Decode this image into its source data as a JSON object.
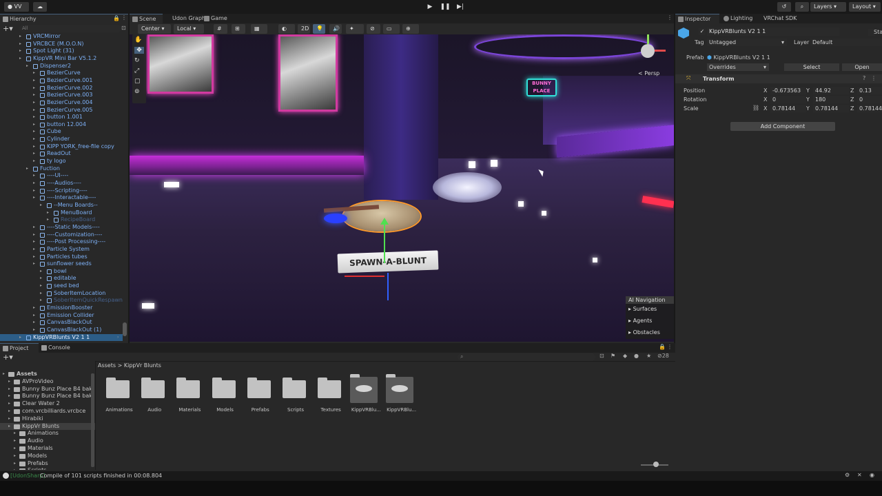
{
  "topbar": {
    "account": "VV",
    "layers": "Layers",
    "layout": "Layout"
  },
  "hierarchy": {
    "tab": "Hierarchy",
    "search_placeholder": "All",
    "items": [
      {
        "label": "VRCMirror",
        "depth": 3,
        "state": "normal"
      },
      {
        "label": "VRCBCE (M.O.O.N)",
        "depth": 3,
        "state": "normal"
      },
      {
        "label": "Spot Light (31)",
        "depth": 3,
        "state": "normal"
      },
      {
        "label": "KippVR Mini Bar V5.1.2",
        "depth": 3,
        "state": "normal"
      },
      {
        "label": "Dispenser2",
        "depth": 4,
        "state": "normal"
      },
      {
        "label": "BezierCurve",
        "depth": 5,
        "state": "normal"
      },
      {
        "label": "BezierCurve.001",
        "depth": 5,
        "state": "normal"
      },
      {
        "label": "BezierCurve.002",
        "depth": 5,
        "state": "normal"
      },
      {
        "label": "BezierCurve.003",
        "depth": 5,
        "state": "normal"
      },
      {
        "label": "BezierCurve.004",
        "depth": 5,
        "state": "normal"
      },
      {
        "label": "BezierCurve.005",
        "depth": 5,
        "state": "normal"
      },
      {
        "label": "button 1.001",
        "depth": 5,
        "state": "normal"
      },
      {
        "label": "button 12.004",
        "depth": 5,
        "state": "normal"
      },
      {
        "label": "Cube",
        "depth": 5,
        "state": "normal"
      },
      {
        "label": "Cylinder",
        "depth": 5,
        "state": "normal"
      },
      {
        "label": "KIPP YORK_free-file copy",
        "depth": 5,
        "state": "normal"
      },
      {
        "label": "ReadOut",
        "depth": 5,
        "state": "normal"
      },
      {
        "label": "ty logo",
        "depth": 5,
        "state": "normal"
      },
      {
        "label": "Fuction",
        "depth": 4,
        "state": "normal"
      },
      {
        "label": "----UI----",
        "depth": 5,
        "state": "normal"
      },
      {
        "label": "----Audios----",
        "depth": 5,
        "state": "normal"
      },
      {
        "label": "----Scripting----",
        "depth": 5,
        "state": "normal"
      },
      {
        "label": "----Interactable----",
        "depth": 5,
        "state": "normal"
      },
      {
        "label": "--Menu Boards--",
        "depth": 6,
        "state": "normal"
      },
      {
        "label": "MenuBoard",
        "depth": 7,
        "state": "normal"
      },
      {
        "label": "RecipeBoard",
        "depth": 7,
        "state": "dim"
      },
      {
        "label": "----Static Models----",
        "depth": 5,
        "state": "normal"
      },
      {
        "label": "----Customization----",
        "depth": 5,
        "state": "normal"
      },
      {
        "label": "----Post Processing----",
        "depth": 5,
        "state": "normal"
      },
      {
        "label": "Particle System",
        "depth": 5,
        "state": "normal"
      },
      {
        "label": "Particles tubes",
        "depth": 5,
        "state": "normal"
      },
      {
        "label": "sunflower seeds",
        "depth": 5,
        "state": "normal"
      },
      {
        "label": "bowl",
        "depth": 6,
        "state": "normal"
      },
      {
        "label": "editable",
        "depth": 6,
        "state": "normal"
      },
      {
        "label": "seed bed",
        "depth": 6,
        "state": "normal"
      },
      {
        "label": "SoberItemLocation",
        "depth": 6,
        "state": "normal"
      },
      {
        "label": "SoberItemQuickRespawn",
        "depth": 6,
        "state": "dim"
      },
      {
        "label": "EmissionBooster",
        "depth": 5,
        "state": "normal"
      },
      {
        "label": "Emission Collider",
        "depth": 5,
        "state": "normal"
      },
      {
        "label": "CanvasBlackOut",
        "depth": 5,
        "state": "normal"
      },
      {
        "label": "CanvasBlackOut (1)",
        "depth": 5,
        "state": "normal"
      },
      {
        "label": "KippVRBlunts V2 1 1",
        "depth": 3,
        "state": "selected"
      }
    ]
  },
  "scene": {
    "tabs": [
      "Scene",
      "Udon Graph",
      "Game"
    ],
    "pivot": "Center",
    "space": "Local",
    "mode_2d": "2D",
    "persp": "< Persp",
    "label_text": "SPAWN-A-BLUNT",
    "neon_sign": "BUNNY PLACE",
    "ai_nav": {
      "title": "AI Navigation",
      "items": [
        "Surfaces",
        "Agents",
        "Obstacles"
      ]
    }
  },
  "inspector": {
    "tabs": [
      "Inspector",
      "Lighting",
      "VRChat SDK"
    ],
    "object_name": "KippVRBlunts V2 1 1",
    "static_label": "Static",
    "tag_label": "Tag",
    "tag_value": "Untagged",
    "layer_label": "Layer",
    "layer_value": "Default",
    "prefab_label": "Prefab",
    "prefab_value": "KippVRBlunts V2 1 1",
    "overrides": "Overrides",
    "select": "Select",
    "open": "Open",
    "transform": {
      "title": "Transform",
      "position_label": "Position",
      "rotation_label": "Rotation",
      "scale_label": "Scale",
      "position": {
        "x": "-0.673563",
        "y": "44.92",
        "z": "0.13"
      },
      "rotation": {
        "x": "0",
        "y": "180",
        "z": "0"
      },
      "scale": {
        "x": "0.78144",
        "y": "0.78144",
        "z": "0.78144"
      }
    },
    "add_component": "Add Component"
  },
  "project": {
    "tabs": [
      "Project",
      "Console"
    ],
    "breadcrumb": [
      "Assets",
      "KippVr Blunts"
    ],
    "count": "28",
    "tree": [
      {
        "label": "Assets",
        "depth": 0,
        "bold": true
      },
      {
        "label": "AVProVideo",
        "depth": 1
      },
      {
        "label": "Bunny Bunz Place B4 bak",
        "depth": 1
      },
      {
        "label": "Bunny Bunz Place B4 bak",
        "depth": 1
      },
      {
        "label": "Clear Water 2",
        "depth": 1
      },
      {
        "label": "com.vrcbilliards.vrcbce",
        "depth": 1
      },
      {
        "label": "Hirabiki",
        "depth": 1
      },
      {
        "label": "KippVr Blunts",
        "depth": 1,
        "selected": true
      },
      {
        "label": "Animations",
        "depth": 2
      },
      {
        "label": "Audio",
        "depth": 2
      },
      {
        "label": "Materials",
        "depth": 2
      },
      {
        "label": "Models",
        "depth": 2
      },
      {
        "label": "Prefabs",
        "depth": 2
      },
      {
        "label": "Scripts",
        "depth": 2
      }
    ],
    "assets": [
      {
        "label": "Animations",
        "kind": "folder"
      },
      {
        "label": "Audio",
        "kind": "folder"
      },
      {
        "label": "Materials",
        "kind": "folder"
      },
      {
        "label": "Models",
        "kind": "folder"
      },
      {
        "label": "Prefabs",
        "kind": "folder"
      },
      {
        "label": "Scripts",
        "kind": "folder"
      },
      {
        "label": "Textures",
        "kind": "folder"
      },
      {
        "label": "KippVRBlu...",
        "kind": "prefab"
      },
      {
        "label": "KippVRBlu...",
        "kind": "prefab"
      }
    ]
  },
  "status": {
    "tag": "[UdonSharp]",
    "message": " Compile of 101 scripts finished in 00:08.804"
  }
}
